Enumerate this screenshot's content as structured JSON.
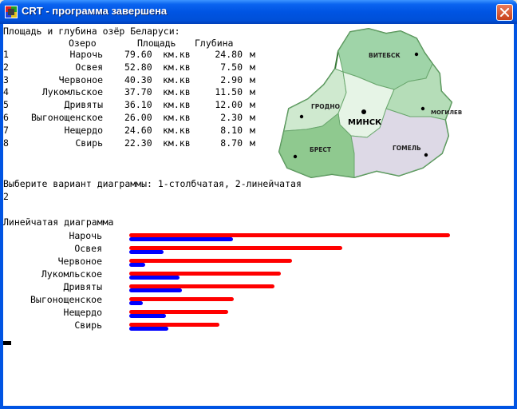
{
  "window": {
    "title": "CRT - программа завершена"
  },
  "console": {
    "heading": "Площадь и глубина озёр Беларуси:",
    "columns": {
      "lake": "Озеро",
      "area": "Площадь",
      "depth": "Глубина"
    },
    "lakes": [
      {
        "idx": "1",
        "name": "Нарочь",
        "area": "79.60",
        "area_unit": "км.кв",
        "depth": "24.80",
        "depth_unit": "м"
      },
      {
        "idx": "2",
        "name": "Освея",
        "area": "52.80",
        "area_unit": "км.кв",
        "depth": "7.50",
        "depth_unit": "м"
      },
      {
        "idx": "3",
        "name": "Червоное",
        "area": "40.30",
        "area_unit": "км.кв",
        "depth": "2.90",
        "depth_unit": "м"
      },
      {
        "idx": "4",
        "name": "Лукомльское",
        "area": "37.70",
        "area_unit": "км.кв",
        "depth": "11.50",
        "depth_unit": "м"
      },
      {
        "idx": "5",
        "name": "Дривяты",
        "area": "36.10",
        "area_unit": "км.кв",
        "depth": "12.00",
        "depth_unit": "м"
      },
      {
        "idx": "6",
        "name": "Выгонощенское",
        "area": "26.00",
        "area_unit": "км.кв",
        "depth": "2.30",
        "depth_unit": "м"
      },
      {
        "idx": "7",
        "name": "Нещердо",
        "area": "24.60",
        "area_unit": "км.кв",
        "depth": "8.10",
        "depth_unit": "м"
      },
      {
        "idx": "8",
        "name": "Свирь",
        "area": "22.30",
        "area_unit": "км.кв",
        "depth": "8.70",
        "depth_unit": "м"
      }
    ],
    "prompt": "Выберите вариант диаграммы: 1-столбчатая, 2-линейчатая",
    "input": "2",
    "chart_title": "Линейчатая диаграмма"
  },
  "map": {
    "regions": {
      "vitebsk": "ВИТЕБСК",
      "grodno": "ГРОДНО",
      "minsk": "МИНСК",
      "mogilev": "МОГИЛЕВ",
      "brest": "БРЕСТ",
      "gomel": "ГОМЕЛЬ"
    }
  },
  "colors": {
    "area_bar": "#ff0000",
    "depth_bar": "#0000ff"
  },
  "chart_data": {
    "type": "bar",
    "orientation": "horizontal",
    "categories": [
      "Нарочь",
      "Освея",
      "Червоное",
      "Лукомльское",
      "Дривяты",
      "Выгонощенское",
      "Нещердо",
      "Свирь"
    ],
    "series": [
      {
        "values": [
          79.6,
          52.8,
          40.3,
          37.7,
          36.1,
          26.0,
          24.6,
          22.3
        ],
        "color": "#ff0000"
      },
      {
        "values": [
          24.8,
          7.5,
          2.9,
          11.5,
          12.0,
          2.3,
          8.1,
          8.7
        ],
        "color": "#0000ff"
      }
    ],
    "title": "Линейчатая диаграмма",
    "xlim": [
      0,
      80
    ],
    "grid": false,
    "legend": "none"
  }
}
